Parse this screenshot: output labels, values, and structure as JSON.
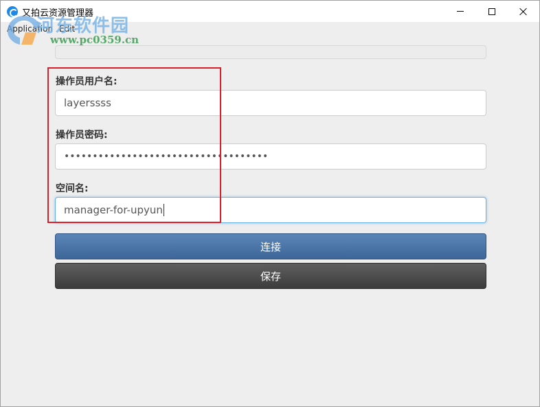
{
  "window": {
    "title": "又拍云资源管理器"
  },
  "menu": {
    "application": "Application",
    "edit": "Edit"
  },
  "watermark": {
    "title": "河东软件园",
    "url": "www.pc0359.cn"
  },
  "form": {
    "username_label": "操作员用户名:",
    "username_value": "layerssss",
    "password_label": "操作员密码:",
    "password_value": "••••••••••••••••••••••••••••••••••••",
    "bucket_label": "空间名:",
    "bucket_value": "manager-for-upyun"
  },
  "buttons": {
    "connect_label": "连接",
    "save_label": "保存"
  },
  "colors": {
    "connect_button": "#4a74a8",
    "save_button": "#4a4a4a",
    "highlight_border": "#d9202a"
  }
}
